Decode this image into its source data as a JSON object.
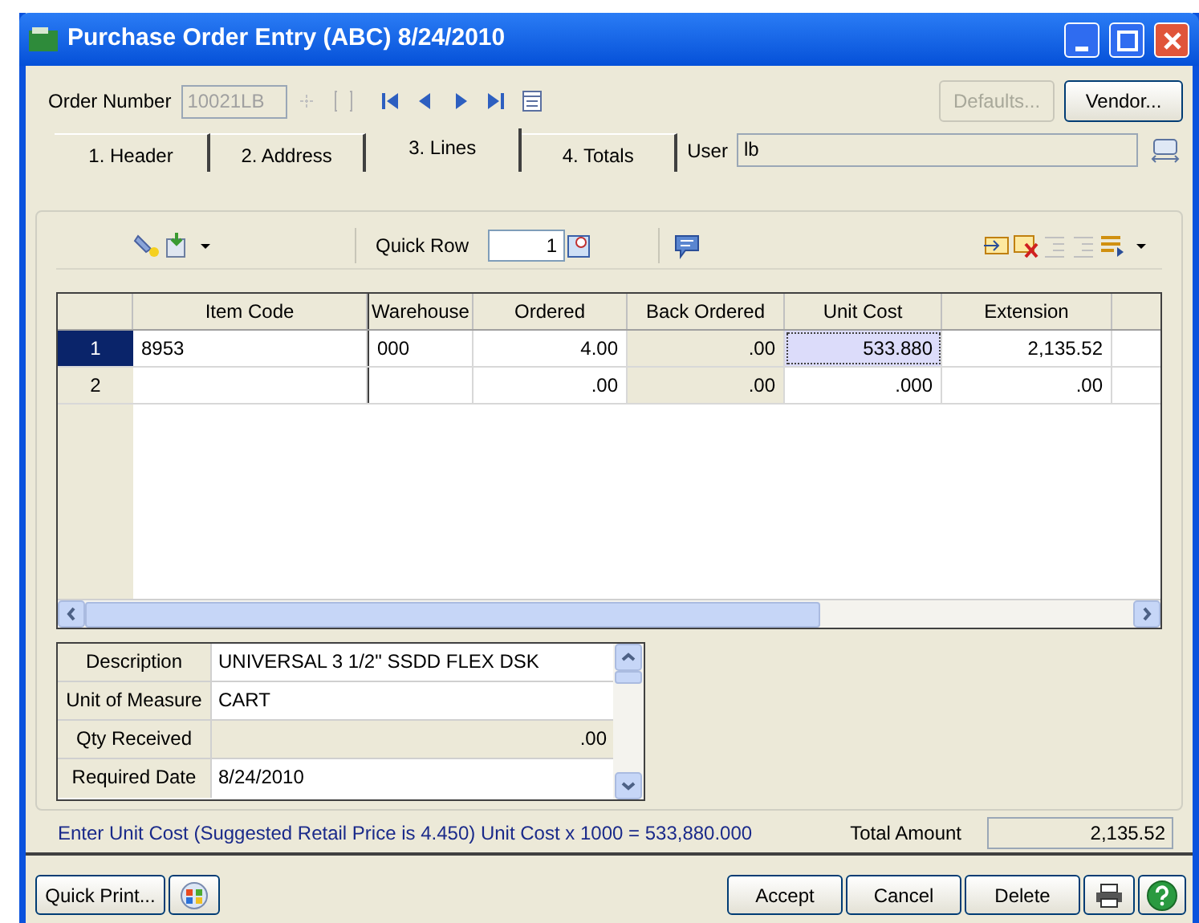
{
  "window": {
    "title": "Purchase Order Entry (ABC) 8/24/2010"
  },
  "header": {
    "order_number_label": "Order Number",
    "order_number": "10021LB",
    "buttons": [
      {
        "label": "Defaults...",
        "disabled": true
      },
      {
        "label": "Vendor...",
        "disabled": false
      }
    ]
  },
  "tabs": [
    {
      "label": "1. Header",
      "selected": false
    },
    {
      "label": "2. Address",
      "selected": false
    },
    {
      "label": "3. Lines",
      "selected": true
    },
    {
      "label": "4. Totals",
      "selected": false
    }
  ],
  "user": {
    "label": "User",
    "value": "lb"
  },
  "toolbar": {
    "quick_row_label": "Quick Row",
    "quick_row": "1"
  },
  "grid": {
    "columns": [
      "Item Code",
      "Warehouse",
      "Ordered",
      "Back Ordered",
      "Unit Cost",
      "Extension"
    ],
    "rows": [
      {
        "number": "1",
        "selected": true,
        "cells": [
          "8953",
          "000",
          "4.00",
          ".00",
          "533.880",
          "2,135.52"
        ]
      },
      {
        "number": "2",
        "selected": false,
        "cells": [
          "",
          "",
          ".00",
          ".00",
          ".000",
          ".00"
        ]
      }
    ]
  },
  "details": [
    {
      "label": "Description",
      "value": "UNIVERSAL 3 1/2\" SSDD FLEX DSK",
      "readonly": false
    },
    {
      "label": "Unit of Measure",
      "value": "CART",
      "readonly": false
    },
    {
      "label": "Qty Received",
      "value": ".00",
      "readonly": true
    },
    {
      "label": "Required Date",
      "value": "8/24/2010",
      "readonly": false
    }
  ],
  "status": {
    "message": "Enter Unit Cost (Suggested Retail Price is 4.450) Unit Cost x 1000 = 533,880.000",
    "total_label": "Total Amount",
    "total": "2,135.52"
  },
  "footer": {
    "left_button": "Quick Print...",
    "buttons": [
      "Accept",
      "Cancel",
      "Delete"
    ]
  }
}
